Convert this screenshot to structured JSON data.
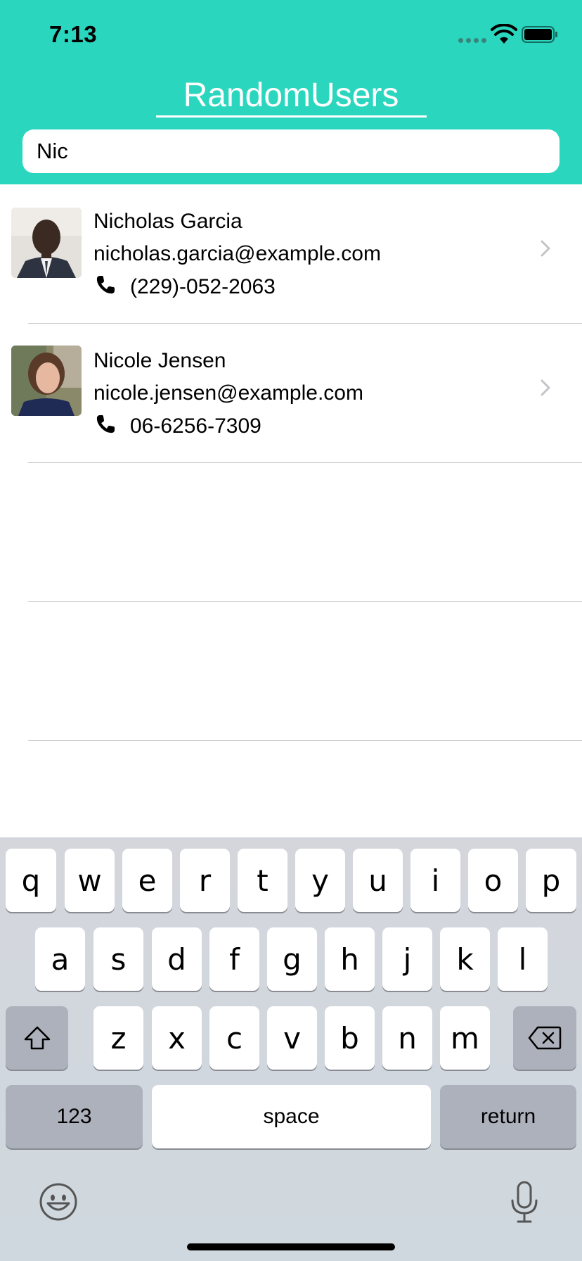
{
  "status_bar": {
    "time": "7:13"
  },
  "header": {
    "title": "RandomUsers",
    "accent_color": "#2bd6bf"
  },
  "search": {
    "value": "Nic"
  },
  "users": [
    {
      "name": "Nicholas Garcia",
      "email": "nicholas.garcia@example.com",
      "phone": "(229)-052-2063"
    },
    {
      "name": "Nicole Jensen",
      "email": "nicole.jensen@example.com",
      "phone": "06-6256-7309"
    }
  ],
  "keyboard": {
    "row1": [
      "q",
      "w",
      "e",
      "r",
      "t",
      "y",
      "u",
      "i",
      "o",
      "p"
    ],
    "row2": [
      "a",
      "s",
      "d",
      "f",
      "g",
      "h",
      "j",
      "k",
      "l"
    ],
    "row3": [
      "z",
      "x",
      "c",
      "v",
      "b",
      "n",
      "m"
    ],
    "numbers_key": "123",
    "space_key": "space",
    "return_key": "return"
  }
}
